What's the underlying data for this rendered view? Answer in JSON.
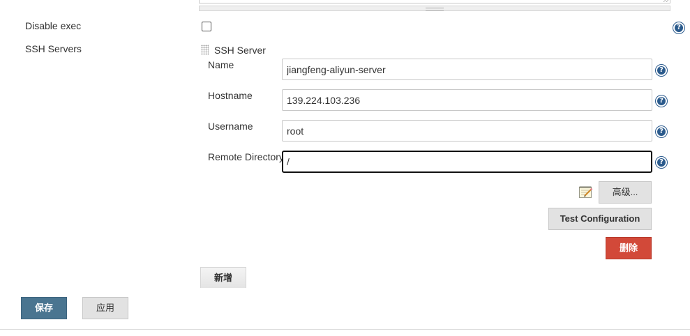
{
  "form": {
    "disable_exec_label": "Disable exec",
    "ssh_servers_label": "SSH Servers",
    "ssh_server_block_title": "SSH Server",
    "name_label": "Name",
    "name_value": "jiangfeng-aliyun-server",
    "hostname_label": "Hostname",
    "hostname_value": "139.224.103.236",
    "username_label": "Username",
    "username_value": "root",
    "remote_directory_label": "Remote Directory",
    "remote_directory_value": "/",
    "disable_exec_checked": false
  },
  "buttons": {
    "advanced": "高级...",
    "test_configuration": "Test Configuration",
    "delete": "删除",
    "add": "新增",
    "save": "保存",
    "apply": "应用"
  },
  "icons": {
    "help": "help-icon",
    "help_glyph": "?",
    "notepad": "notepad-icon",
    "drag_handle": "drag-handle-icon"
  },
  "colors": {
    "help_blue": "#2a5a8c",
    "delete_red": "#d24939",
    "save_blue": "#4a7590"
  }
}
